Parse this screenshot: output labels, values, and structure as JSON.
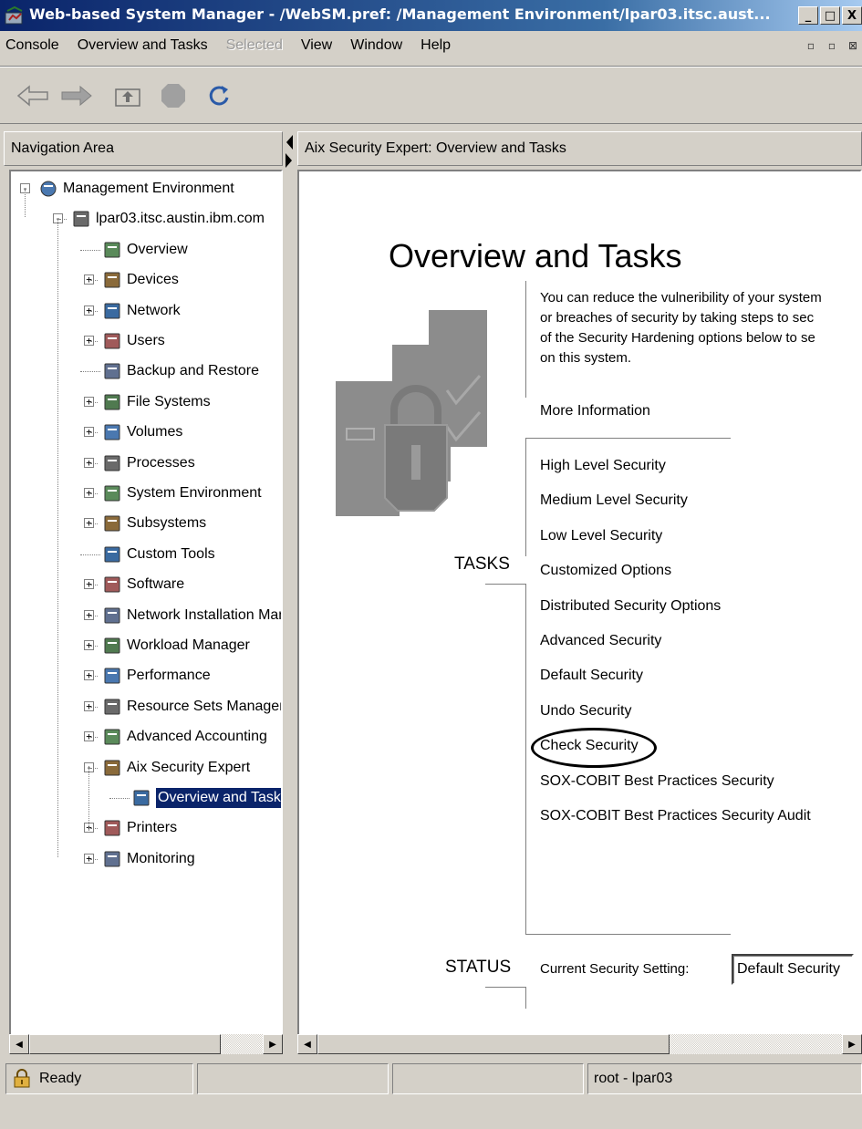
{
  "window": {
    "title": "Web-based System Manager - /WebSM.pref: /Management Environment/lpar03.itsc.aust...",
    "minimize": "_",
    "maximize": "□",
    "close": "X"
  },
  "menu": {
    "items": [
      "Console",
      "Overview and Tasks",
      "Selected",
      "View",
      "Window",
      "Help"
    ]
  },
  "toolbar": {
    "buttons": [
      "back-arrow-icon",
      "forward-arrow-icon",
      "up-level-icon",
      "stop-icon",
      "refresh-icon"
    ]
  },
  "navigation": {
    "header": "Navigation Area",
    "tree": [
      {
        "label": "Management Environment",
        "level": 0,
        "expander": "-",
        "icon": "globe-icon"
      },
      {
        "label": "lpar03.itsc.austin.ibm.com",
        "level": 1,
        "expander": "-",
        "icon": "server-icon"
      },
      {
        "label": "Overview",
        "level": 2,
        "expander": "",
        "icon": "overview-icon"
      },
      {
        "label": "Devices",
        "level": 2,
        "expander": "+",
        "icon": "devices-icon"
      },
      {
        "label": "Network",
        "level": 2,
        "expander": "+",
        "icon": "network-icon"
      },
      {
        "label": "Users",
        "level": 2,
        "expander": "+",
        "icon": "users-icon"
      },
      {
        "label": "Backup and Restore",
        "level": 2,
        "expander": "",
        "icon": "backup-icon"
      },
      {
        "label": "File Systems",
        "level": 2,
        "expander": "+",
        "icon": "folder-icon"
      },
      {
        "label": "Volumes",
        "level": 2,
        "expander": "+",
        "icon": "volumes-icon"
      },
      {
        "label": "Processes",
        "level": 2,
        "expander": "+",
        "icon": "processes-icon"
      },
      {
        "label": "System Environment",
        "level": 2,
        "expander": "+",
        "icon": "system-environment-icon"
      },
      {
        "label": "Subsystems",
        "level": 2,
        "expander": "+",
        "icon": "subsystems-icon"
      },
      {
        "label": "Custom Tools",
        "level": 2,
        "expander": "",
        "icon": "toolbox-icon"
      },
      {
        "label": "Software",
        "level": 2,
        "expander": "+",
        "icon": "software-icon"
      },
      {
        "label": "Network Installation Management",
        "level": 2,
        "expander": "+",
        "icon": "network-installation-icon"
      },
      {
        "label": "Workload Manager",
        "level": 2,
        "expander": "+",
        "icon": "workload-manager-icon"
      },
      {
        "label": "Performance",
        "level": 2,
        "expander": "+",
        "icon": "performance-icon"
      },
      {
        "label": "Resource Sets Management",
        "level": 2,
        "expander": "+",
        "icon": "resource-sets-icon"
      },
      {
        "label": "Advanced Accounting",
        "level": 2,
        "expander": "+",
        "icon": "accounting-icon"
      },
      {
        "label": "Aix Security Expert",
        "level": 2,
        "expander": "-",
        "icon": "security-expert-icon"
      },
      {
        "label": "Overview and Tasks",
        "level": 3,
        "expander": "",
        "icon": "lock-icon",
        "selected": true
      },
      {
        "label": "Printers",
        "level": 2,
        "expander": "+",
        "icon": "printer-icon"
      },
      {
        "label": "Monitoring",
        "level": 2,
        "expander": "+",
        "icon": "monitoring-icon"
      }
    ]
  },
  "content": {
    "header": "Aix Security Expert: Overview and Tasks",
    "title": "Overview and Tasks",
    "description": [
      "You can reduce the vulneribility of your system",
      " or breaches of security by taking steps to sec",
      "of the Security Hardening options below to se",
      "on this system."
    ],
    "more_info": "More Information",
    "tasks_label": "TASKS",
    "tasks": [
      "High Level Security",
      "Medium Level Security",
      "Low Level Security",
      "Customized Options",
      "Distributed Security Options",
      "Advanced Security",
      "Default Security",
      "Undo Security",
      "Check Security",
      "SOX-COBIT Best Practices Security",
      "SOX-COBIT Best Practices Security Audit"
    ],
    "status_label": "STATUS",
    "current_setting_label": "Current Security Setting:",
    "current_setting_value": "Default Security"
  },
  "statusbar": {
    "state": "Ready",
    "cell2": "",
    "cell3": "",
    "user": "root - lpar03"
  }
}
